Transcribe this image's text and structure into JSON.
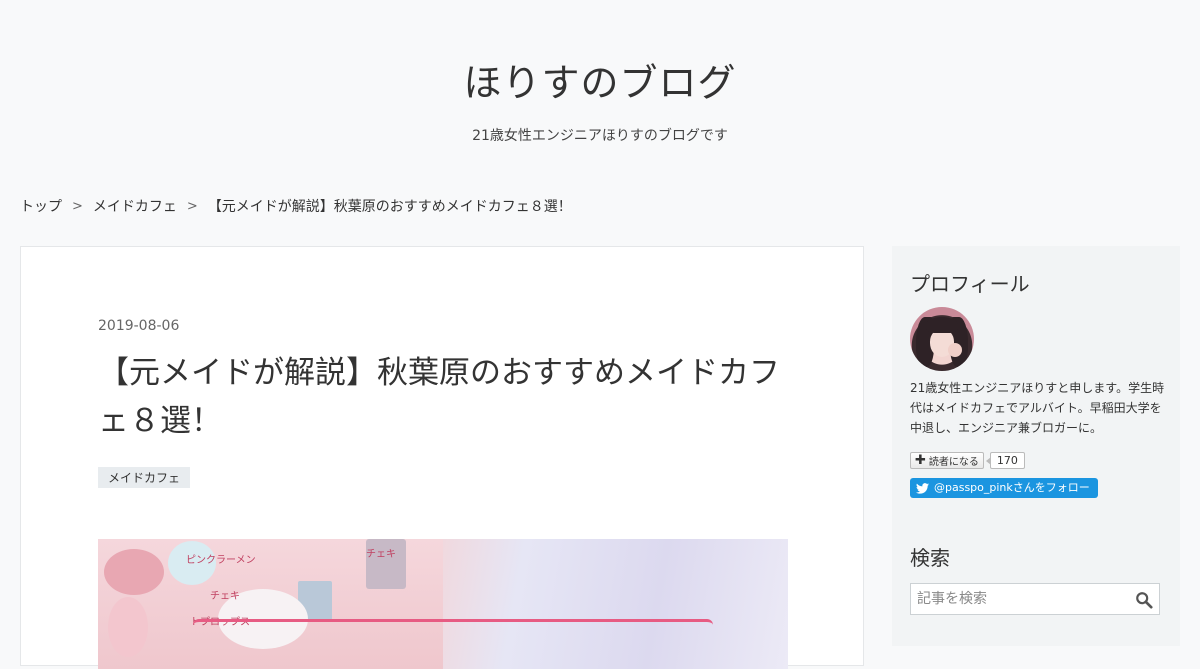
{
  "header": {
    "blog_title": "ほりすのブログ",
    "blog_description": "21歳女性エンジニアほりすのブログです"
  },
  "breadcrumb": {
    "items": [
      "トップ",
      "メイドカフェ",
      "【元メイドが解説】秋葉原のおすすめメイドカフェ８選！"
    ],
    "separator": ">"
  },
  "entry": {
    "date": "2019-08-06",
    "title": "【元メイドが解説】秋葉原のおすすめメイドカフェ８選！",
    "category": "メイドカフェ",
    "eyecatch": {
      "labels": [
        "ピンクラーメン",
        "チェキ",
        "チェキ",
        "トプロップス"
      ]
    }
  },
  "sidebar": {
    "profile": {
      "title": "プロフィール",
      "description": "21歳女性エンジニアほりすと申します。学生時代はメイドカフェでアルバイト。早稲田大学を中退し、エンジニア兼ブロガーに。",
      "reader_button_label": "読者になる",
      "reader_count": "170",
      "twitter_label": "@passpo_pinkさんをフォロー"
    },
    "search": {
      "title": "検索",
      "placeholder": "記事を検索"
    }
  },
  "colors": {
    "background": "#f8f9fa",
    "card": "#ffffff",
    "sidebar": "#f2f4f5",
    "twitter": "#1b95e0",
    "category_badge": "#e8ecef"
  }
}
